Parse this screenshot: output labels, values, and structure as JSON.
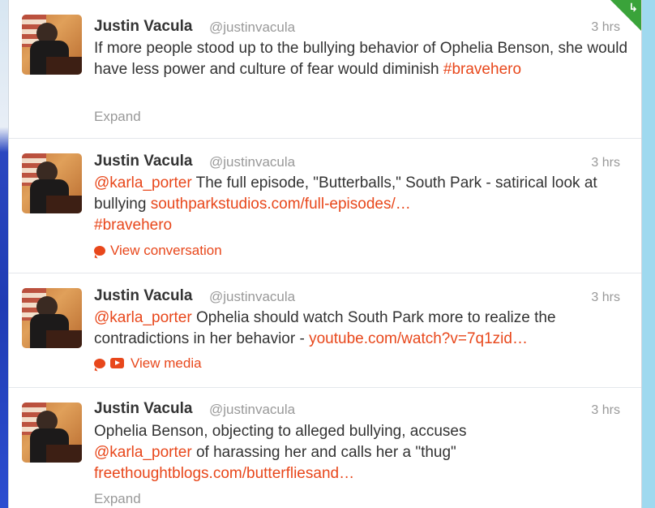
{
  "tweets": [
    {
      "name": "Justin Vacula",
      "handle": "@justinvacula",
      "time": "3 hrs",
      "text_plain_1": "If more people stood up to the bullying behavior of Ophelia Benson, she would have less power and culture of fear would diminish ",
      "hashtag": "#bravehero",
      "action": "Expand",
      "avatar_icon": "profile-photo"
    },
    {
      "name": "Justin Vacula",
      "handle": "@justinvacula",
      "time": "3 hrs",
      "mention": "@karla_porter",
      "text_plain_1": " The full episode, \"Butterballs,\" South Park - satirical look at bullying ",
      "link": "southparkstudios.com/full-episodes/…",
      "hashtag": "#bravehero",
      "action": "View conversation",
      "action_icon": "speech-bubble-icon"
    },
    {
      "name": "Justin Vacula",
      "handle": "@justinvacula",
      "time": "3 hrs",
      "mention": "@karla_porter",
      "text_plain_1": " Ophelia should watch South Park more to realize the contradictions in her behavior - ",
      "link": "youtube.com/watch?v=7q1zid…",
      "action": "View media",
      "action_icons": [
        "speech-bubble-icon",
        "play-video-icon"
      ]
    },
    {
      "name": "Justin Vacula",
      "handle": "@justinvacula",
      "time": "3 hrs",
      "text_plain_1": "Ophelia Benson, objecting to alleged bullying, accuses ",
      "mention": "@karla_porter",
      "text_plain_2": " of harassing her and calls her a \"thug\" ",
      "link": "freethoughtblogs.com/butterfliesand…",
      "action": "Expand"
    }
  ],
  "colors": {
    "link": "#e8471b",
    "name": "#333333",
    "meta": "#999999",
    "badge": "#3aa33a"
  }
}
